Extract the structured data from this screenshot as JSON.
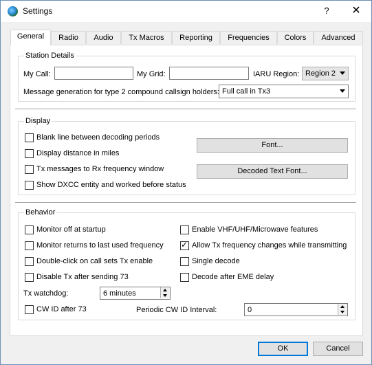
{
  "window": {
    "title": "Settings",
    "help": "?",
    "close": "✕"
  },
  "tabs": [
    {
      "label": "General"
    },
    {
      "label": "Radio"
    },
    {
      "label": "Audio"
    },
    {
      "label": "Tx Macros"
    },
    {
      "label": "Reporting"
    },
    {
      "label": "Frequencies"
    },
    {
      "label": "Colors"
    },
    {
      "label": "Advanced"
    }
  ],
  "station": {
    "title": "Station Details",
    "my_call_label": "My Call:",
    "my_call_value": "",
    "my_grid_label": "My Grid:",
    "my_grid_value": "",
    "iaru_label": "IARU Region:",
    "iaru_value": "Region 2",
    "msg_gen_label": "Message generation for type 2 compound callsign holders:",
    "msg_gen_value": "Full call in Tx3"
  },
  "display": {
    "title": "Display",
    "blank_line": "Blank line between decoding periods",
    "distance_miles": "Display distance in miles",
    "tx_to_rx": "Tx messages to Rx frequency window",
    "dxcc": "Show DXCC entity and worked before status",
    "font_btn": "Font...",
    "decoded_font_btn": "Decoded Text Font..."
  },
  "behavior": {
    "title": "Behavior",
    "monitor_off": "Monitor off at startup",
    "monitor_returns": "Monitor returns to last used frequency",
    "double_click": "Double-click on call sets Tx enable",
    "disable_tx": "Disable Tx after sending 73",
    "enable_vhf": "Enable VHF/UHF/Microwave features",
    "allow_tx_freq": "Allow Tx frequency changes while transmitting",
    "single_decode": "Single decode",
    "decode_eme": "Decode after EME delay",
    "tx_watchdog_label": "Tx watchdog:",
    "tx_watchdog_value": "6 minutes",
    "cw_id": "CW ID after 73",
    "periodic_cw_label": "Periodic CW ID Interval:",
    "periodic_cw_value": "0",
    "check_mark": "✓"
  },
  "footer": {
    "ok": "OK",
    "cancel": "Cancel"
  }
}
